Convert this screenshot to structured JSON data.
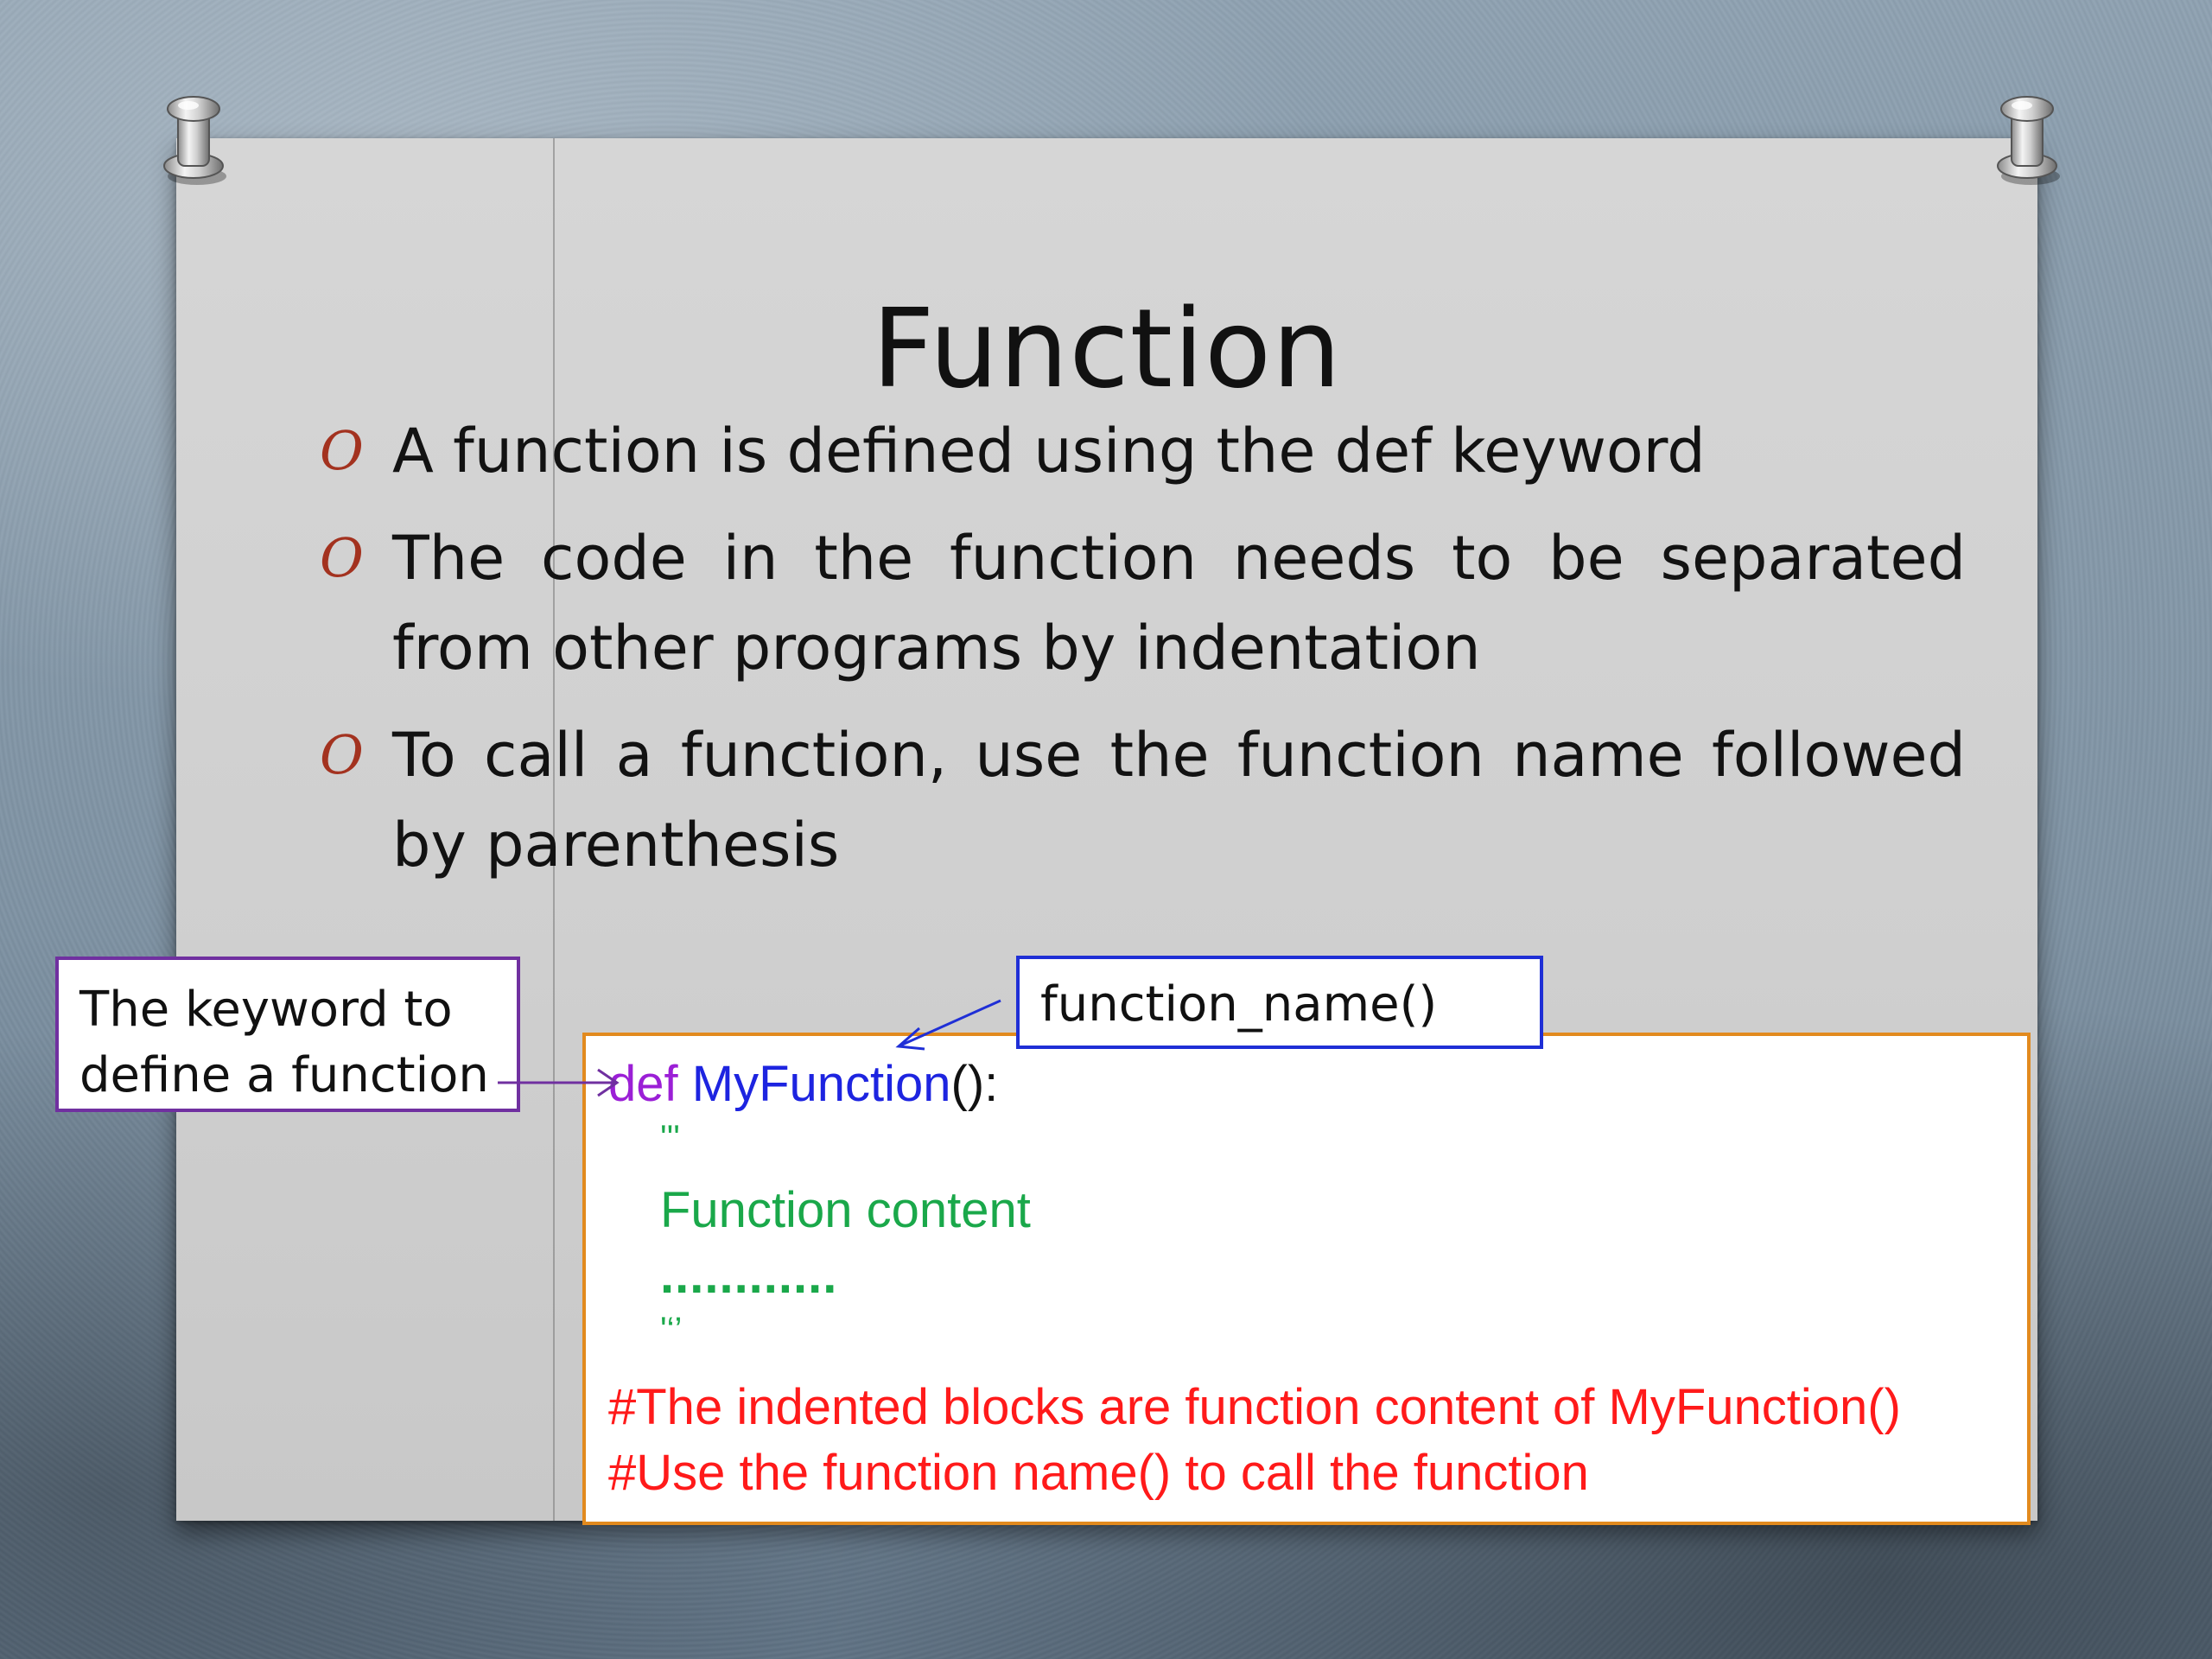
{
  "slide": {
    "title": "Function",
    "bullet_marker": "O",
    "bullets": [
      "A function is defined using the def keyword",
      "The code in the function needs to be separated from other programs by indentation",
      "To call a function, use the function name followed by parenthesis"
    ]
  },
  "callouts": {
    "keyword_line1": "The keyword to",
    "keyword_line2": "define a function",
    "function_name": "function_name()"
  },
  "code": {
    "def_keyword": "def",
    "function_name": "MyFunction",
    "def_suffix": "():",
    "docstring_open": "'''",
    "content": "Function content",
    "dots": "............",
    "docstring_close": "'‘’",
    "comment_1": "#The indented blocks are function content of MyFunction()",
    "comment_2": "#Use the function name() to call the function"
  },
  "colors": {
    "keyword_box_border": "#7030a0",
    "name_box_border": "#1f2fd6",
    "code_box_border": "#e28a1e",
    "def_keyword": "#9b1fd6",
    "function_name": "#1d24e0",
    "docstring": "#1aa84a",
    "comment": "#ff1a1a",
    "bullet_marker": "#a3321f"
  },
  "icons": {
    "pin_left": "pushpin-icon",
    "pin_right": "pushpin-icon"
  }
}
